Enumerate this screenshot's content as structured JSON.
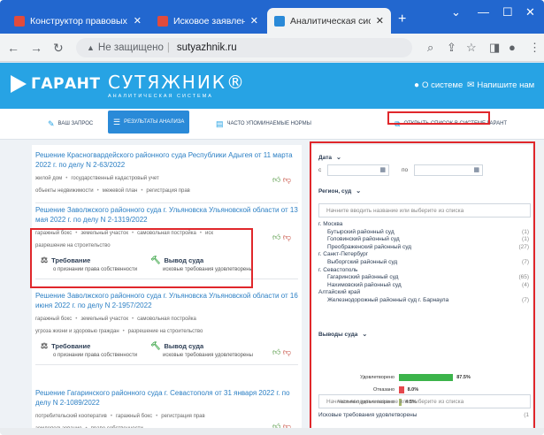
{
  "browser": {
    "tabs": [
      {
        "title": "Конструктор правовых до",
        "icon": "garant-favicon",
        "active": false
      },
      {
        "title": "Исковое заявление о приз",
        "icon": "garant-favicon",
        "active": false
      },
      {
        "title": "Аналитическая система С",
        "icon": "sutyazhnik-favicon",
        "active": true
      }
    ],
    "new_tab": "+",
    "close": "✕",
    "address": {
      "security": "Не защищено",
      "url": "sutyazhnik.ru"
    }
  },
  "app": {
    "logo": "ГАРАНТ",
    "brand_name": "СУТЯЖНИК®",
    "brand_sub": "АНАЛИТИЧЕСКАЯ СИСТЕМА",
    "header_links": {
      "about": "О системе",
      "contact": "Напишите нам"
    },
    "tabs": {
      "request": "ВАШ ЗАПРОС",
      "results": "РЕЗУЛЬТАТЫ АНАЛИЗА",
      "norms": "ЧАСТО УПОМИНАЕМЫЕ НОРМЫ",
      "open_list": "ОТКРЫТЬ СПИСОК В СИСТЕМЕ ГАРАНТ"
    }
  },
  "results": [
    {
      "title": "Решение Красногвардейского районного суда Республики Адыгея от 11 марта 2022 г. по делу N 2-63/2022",
      "tags_lines": [
        [
          "жилой дом",
          "государственный кадастровый учет",
          "объекты недвижимости",
          "межевой план",
          "регистрация прав"
        ]
      ],
      "has_req": false
    },
    {
      "title": "Решение Заволжского районного суда г. Ульяновска Ульяновской области от 13 мая 2022 г. по делу N 2-1319/2022",
      "tags_lines": [
        [
          "гаражный бокс",
          "земельный участок",
          "самовольная постройка",
          "иск"
        ],
        [
          "разрешение на строительство"
        ]
      ],
      "has_req": true,
      "req_label": "Требование",
      "req_value": "о признании права собственности",
      "out_label": "Вывод суда",
      "out_value": "исковые требования удовлетворены"
    },
    {
      "title": "Решение Заволжского районного суда г. Ульяновска Ульяновской области от 16 июня 2022 г. по делу N 2-1957/2022",
      "tags_lines": [
        [
          "гаражный бокс",
          "земельный участок",
          "самовольная постройка"
        ],
        [
          "угроза жизни и здоровью граждан",
          "разрешение на строительство"
        ]
      ],
      "has_req": true,
      "req_label": "Требование",
      "req_value": "о признании права собственности",
      "out_label": "Вывод суда",
      "out_value": "исковые требования удовлетворены"
    },
    {
      "title": "Решение Гагаринского районного суда г. Севастополя от 31 января 2022 г. по делу N 2-1089/2022",
      "tags_lines": [
        [
          "потребительский кооператив",
          "гаражный бокс",
          "регистрация прав"
        ],
        [
          "землепользование",
          "право собственности"
        ]
      ],
      "has_req": false
    }
  ],
  "filters": {
    "date_label": "Дата",
    "from": "с",
    "to": "по",
    "region_label": "Регион, суд",
    "search_placeholder": "Начните вводить название или выберите из списка",
    "regions": [
      {
        "name": "г. Москва",
        "count": "",
        "level": 0
      },
      {
        "name": "Бутырский районный суд",
        "count": "(1)",
        "level": 1
      },
      {
        "name": "Головинский районный суд",
        "count": "(1)",
        "level": 1
      },
      {
        "name": "Преображенский районный суд",
        "count": "(27)",
        "level": 1
      },
      {
        "name": "г. Санкт-Петербург",
        "count": "",
        "level": 0
      },
      {
        "name": "Выборгский районный суд",
        "count": "(7)",
        "level": 1
      },
      {
        "name": "г. Севастополь",
        "count": "",
        "level": 0
      },
      {
        "name": "Гагаринский районный суд",
        "count": "(65)",
        "level": 1
      },
      {
        "name": "Нахимовский районный суд",
        "count": "(4)",
        "level": 1
      },
      {
        "name": "Алтайский край",
        "count": "",
        "level": 0
      },
      {
        "name": "Железнодорожный районный суд г. Барнаула",
        "count": "(7)",
        "level": 1
      }
    ],
    "outcomes_label": "Выводы суда",
    "outcomes_search_placeholder": "Начните вводить название или выберите из списка",
    "claims_label": "Исковые требования удовлетворены",
    "claims_count": "(1"
  },
  "chart_data": {
    "type": "bar",
    "orientation": "horizontal",
    "categories": [
      "Удовлетворено",
      "Отказано",
      "Частично удовлетворено"
    ],
    "values": [
      87.5,
      8.0,
      4.5
    ],
    "labels": [
      "87.5%",
      "8.0%",
      "4.5%"
    ],
    "colors": [
      "#3cb44b",
      "#e5484d",
      "#a6b96b"
    ]
  }
}
